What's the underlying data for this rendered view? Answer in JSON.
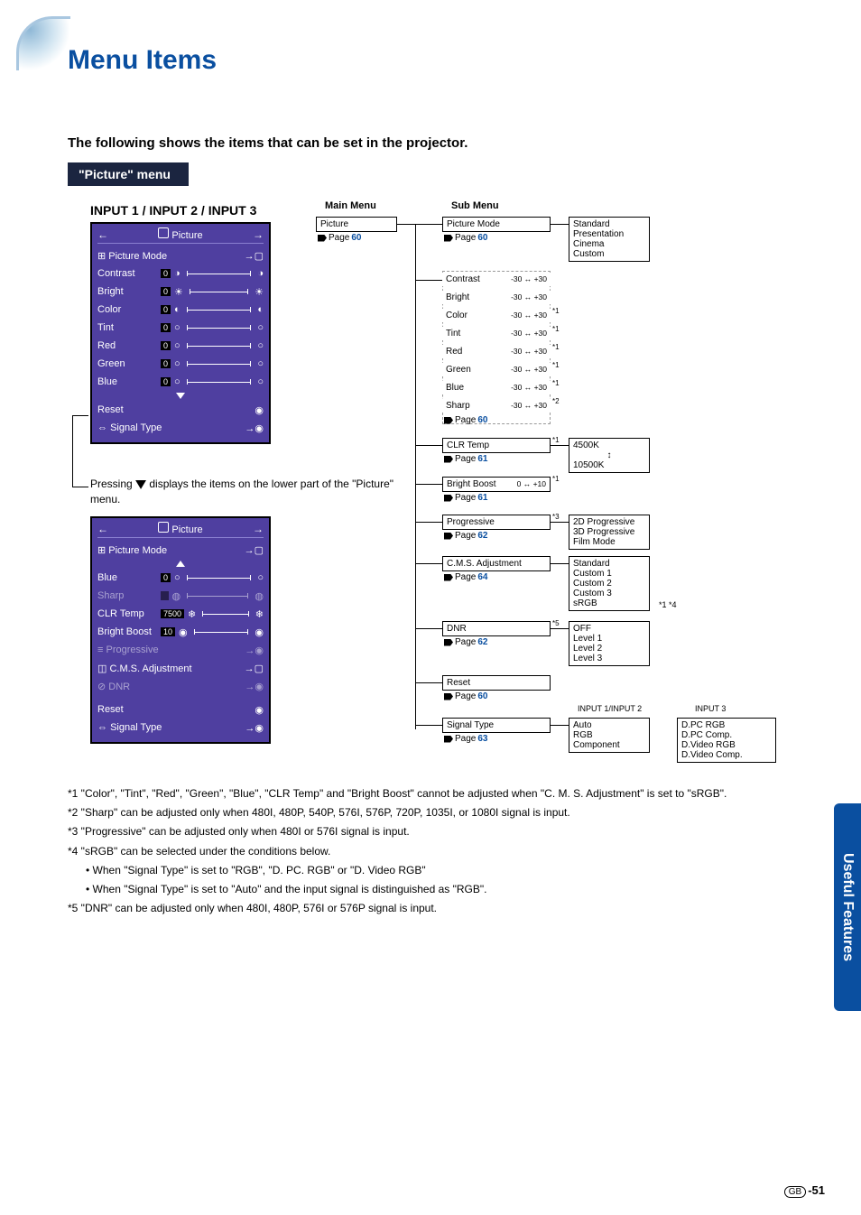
{
  "page": {
    "title": "Menu Items",
    "subtitle": "The following shows the items that can be set in the projector.",
    "menu_band": "\"Picture\" menu",
    "inputs_heading": "INPUT 1 / INPUT 2 / INPUT 3",
    "main_menu_header": "Main Menu",
    "sub_menu_header": "Sub Menu",
    "page_label": "Page",
    "press_note_a": "Pressing ",
    "press_note_b": " displays the items on the lower part of the \"Picture\" menu.",
    "side_tab": "Useful Features",
    "page_number_prefix": "GB",
    "page_number": "-51"
  },
  "osd_top": {
    "title": "Picture",
    "mode_row": "Picture Mode",
    "rows": [
      "Contrast",
      "Bright",
      "Color",
      "Tint",
      "Red",
      "Green",
      "Blue"
    ],
    "reset": "Reset",
    "signal": "Signal Type"
  },
  "osd_bottom": {
    "title": "Picture",
    "mode_row": "Picture Mode",
    "rows_sliders": [
      "Blue",
      "Sharp"
    ],
    "clr_temp_label": "CLR Temp",
    "clr_temp_val": "7500",
    "bright_boost_label": "Bright Boost",
    "bright_boost_val": "10",
    "progressive": "Progressive",
    "cms": "C.M.S. Adjustment",
    "dnr": "DNR",
    "reset": "Reset",
    "signal": "Signal Type"
  },
  "main_box": {
    "label": "Picture",
    "page": "60"
  },
  "sub": {
    "picture_mode": {
      "label": "Picture Mode",
      "page": "60"
    },
    "contrast": {
      "label": "Contrast",
      "range": "-30 ↔ +30"
    },
    "bright": {
      "label": "Bright",
      "range": "-30 ↔ +30"
    },
    "color": {
      "label": "Color",
      "range": "-30 ↔ +30",
      "sup": "*1"
    },
    "tint": {
      "label": "Tint",
      "range": "-30 ↔ +30",
      "sup": "*1"
    },
    "red": {
      "label": "Red",
      "range": "-30 ↔ +30",
      "sup": "*1"
    },
    "green": {
      "label": "Green",
      "range": "-30 ↔ +30",
      "sup": "*1"
    },
    "blue": {
      "label": "Blue",
      "range": "-30 ↔ +30",
      "sup": "*1"
    },
    "sharp": {
      "label": "Sharp",
      "range": "-30 ↔ +30",
      "sup": "*2",
      "page": "60"
    },
    "clr_temp": {
      "label": "CLR Temp",
      "sup": "*1",
      "page": "61"
    },
    "bright_boost": {
      "label": "Bright Boost",
      "range": "0 ↔ +10",
      "sup": "*1",
      "page": "61"
    },
    "progressive": {
      "label": "Progressive",
      "sup": "*3",
      "page": "62"
    },
    "cms": {
      "label": "C.M.S. Adjustment",
      "page": "64"
    },
    "dnr": {
      "label": "DNR",
      "sup": "*5",
      "page": "62"
    },
    "reset": {
      "label": "Reset",
      "page": "60"
    },
    "signal_type": {
      "label": "Signal Type",
      "page": "63"
    }
  },
  "options": {
    "picture_mode": [
      "Standard",
      "Presentation",
      "Cinema",
      "Custom"
    ],
    "clr_temp": [
      "4500K",
      "↕",
      "10500K"
    ],
    "progressive": [
      "2D Progressive",
      "3D Progressive",
      "Film Mode"
    ],
    "cms": [
      "Standard",
      "Custom 1",
      "Custom 2",
      "Custom 3",
      "sRGB"
    ],
    "cms_side": "*1 *4",
    "dnr": [
      "OFF",
      "Level 1",
      "Level 2",
      "Level 3"
    ],
    "signal_in12_header": "INPUT 1/INPUT 2",
    "signal_in12": [
      "Auto",
      "RGB",
      "Component"
    ],
    "signal_in3_header": "INPUT 3",
    "signal_in3": [
      "D.PC RGB",
      "D.PC Comp.",
      "D.Video RGB",
      "D.Video Comp."
    ]
  },
  "footnotes": {
    "f1": "*1 \"Color\", \"Tint\", \"Red\", \"Green\", \"Blue\", \"CLR Temp\" and \"Bright Boost\" cannot be adjusted when \"C. M. S. Adjustment\" is set to \"sRGB\".",
    "f2": "*2 \"Sharp\" can be adjusted only when 480I, 480P, 540P, 576I, 576P, 720P, 1035I, or 1080I signal is input.",
    "f3": "*3 \"Progressive\" can be adjusted only when 480I or 576I signal is input.",
    "f4": "*4 \"sRGB\" can be selected under the conditions below.",
    "f4a": "• When \"Signal Type\" is set to \"RGB\", \"D. PC. RGB\" or \"D. Video RGB\"",
    "f4b": "• When \"Signal Type\" is set to \"Auto\" and the input signal is distinguished as \"RGB\".",
    "f5": "*5 \"DNR\" can be adjusted only when 480I, 480P, 576I or 576P signal is input."
  }
}
